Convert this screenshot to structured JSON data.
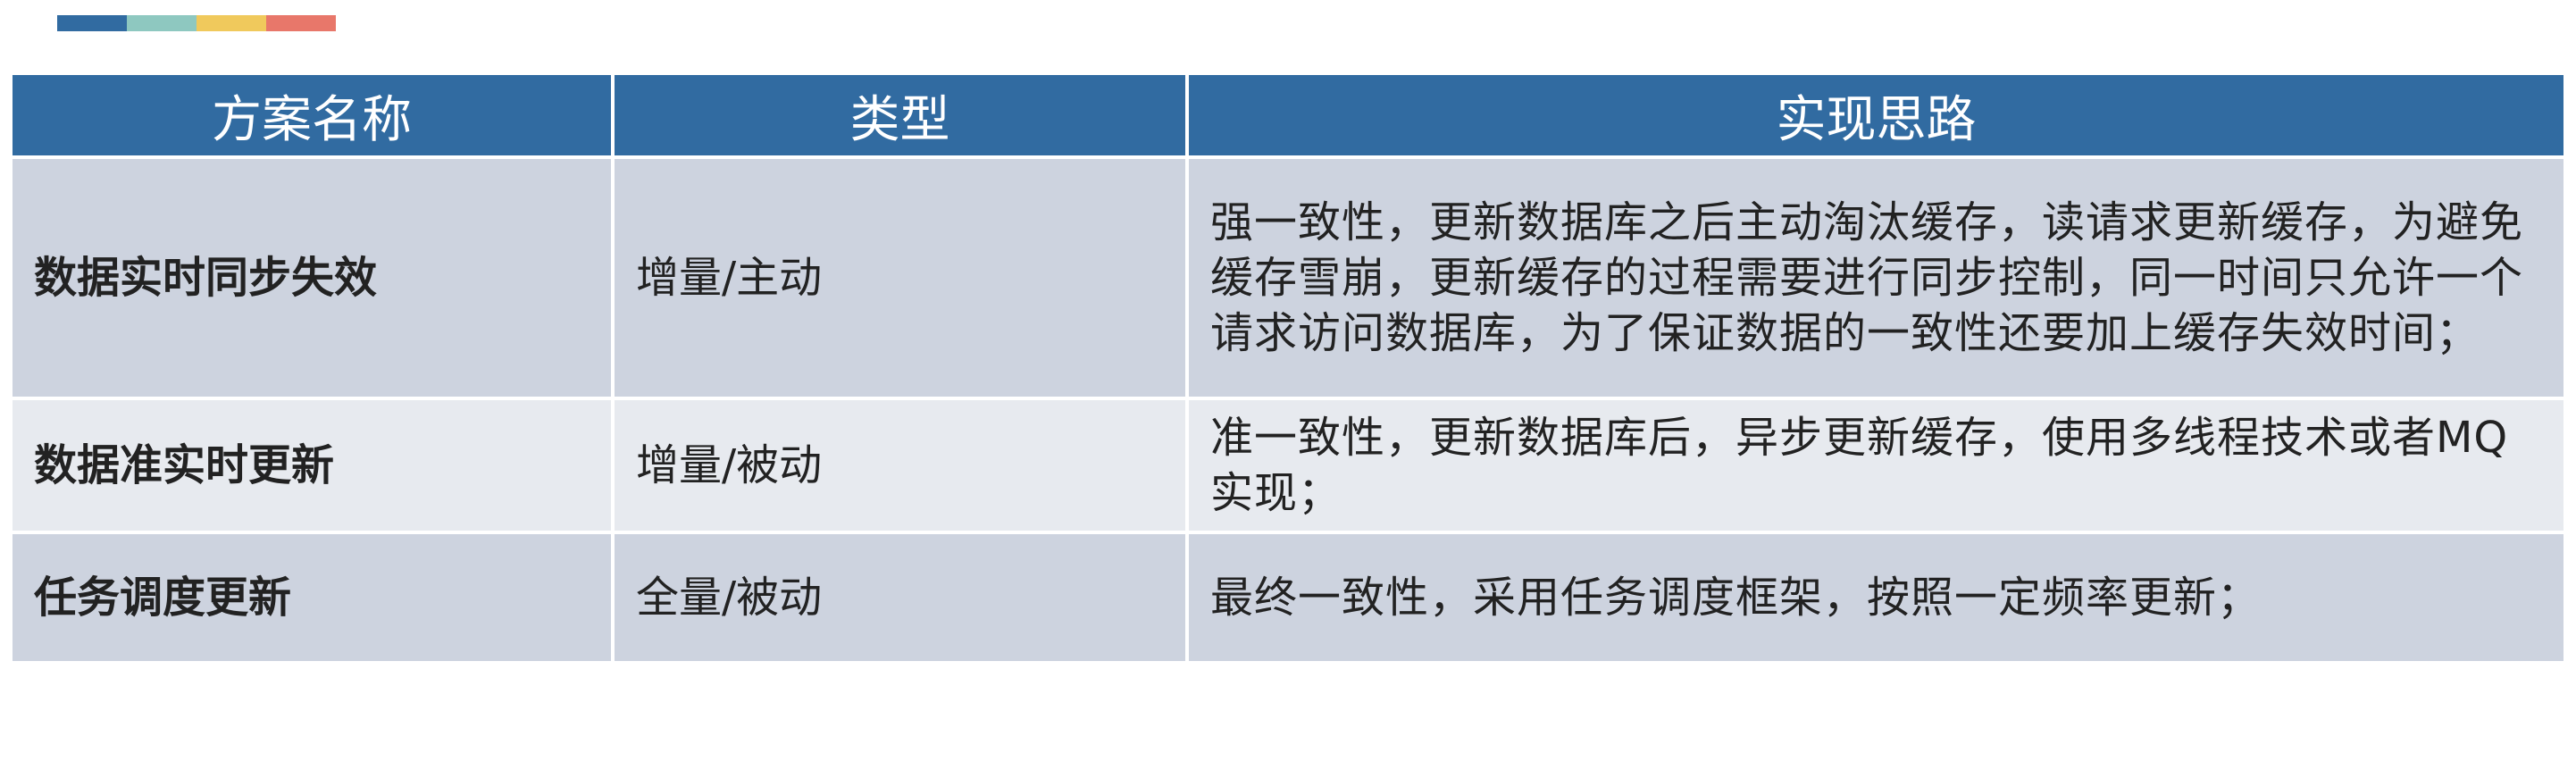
{
  "accent_colors": [
    "#316ba1",
    "#8ec8c0",
    "#f0c95c",
    "#e8776a"
  ],
  "table": {
    "headers": [
      "方案名称",
      "类型",
      "实现思路"
    ],
    "rows": [
      {
        "name": "数据实时同步失效",
        "type": "增量/主动",
        "idea": "强一致性，更新数据库之后主动淘汰缓存，读请求更新缓存，为避免缓存雪崩，更新缓存的过程需要进行同步控制，同一时间只允许一个请求访问数据库，为了保证数据的一致性还要加上缓存失效时间；"
      },
      {
        "name": "数据准实时更新",
        "type": "增量/被动",
        "idea": "准一致性，更新数据库后，异步更新缓存，使用多线程技术或者MQ实现；"
      },
      {
        "name": "任务调度更新",
        "type": "全量/被动",
        "idea": "最终一致性，采用任务调度框架，按照一定频率更新；"
      }
    ]
  }
}
